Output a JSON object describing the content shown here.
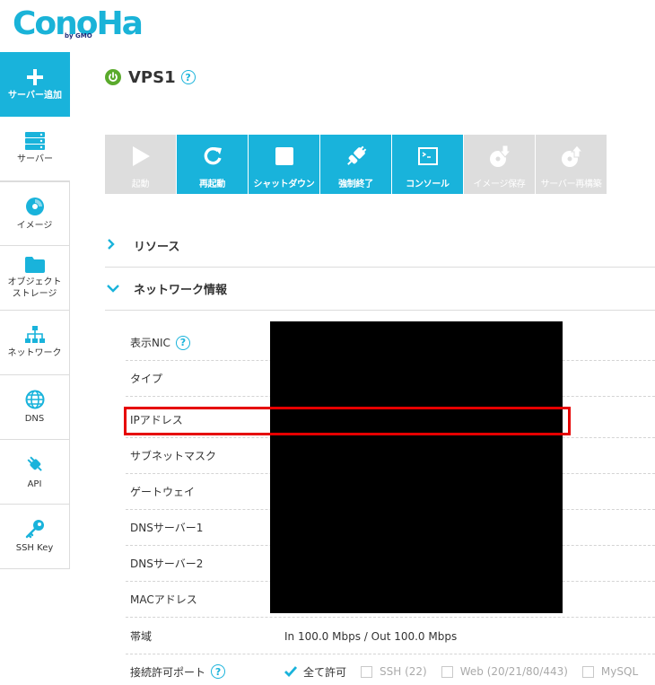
{
  "brand": {
    "logo_text": "ConoHa",
    "logo_sub": "by GMO"
  },
  "sidebar": {
    "items": [
      {
        "label": "サーバー追加"
      },
      {
        "label": "サーバー"
      },
      {
        "label": "イメージ"
      },
      {
        "label": "オブジェクト\nストレージ"
      },
      {
        "label": "ネットワーク"
      },
      {
        "label": "DNS"
      },
      {
        "label": "API"
      },
      {
        "label": "SSH Key"
      }
    ]
  },
  "header": {
    "title": "VPS1",
    "help": "?"
  },
  "toolbar": {
    "buttons": [
      {
        "label": "起動",
        "enabled": false
      },
      {
        "label": "再起動",
        "enabled": true
      },
      {
        "label": "シャットダウン",
        "enabled": true
      },
      {
        "label": "強制終了",
        "enabled": true
      },
      {
        "label": "コンソール",
        "enabled": true
      },
      {
        "label": "イメージ保存",
        "enabled": false
      },
      {
        "label": "サーバー再構築",
        "enabled": false
      }
    ]
  },
  "sections": {
    "resource": {
      "label": "リソース",
      "expanded": false
    },
    "network": {
      "label": "ネットワーク情報",
      "expanded": true
    }
  },
  "network": {
    "rows": [
      {
        "key": "表示NIC",
        "value": ""
      },
      {
        "key": "タイプ",
        "value": ""
      },
      {
        "key": "IPアドレス",
        "value": ""
      },
      {
        "key": "サブネットマスク",
        "value": ""
      },
      {
        "key": "ゲートウェイ",
        "value": ""
      },
      {
        "key": "DNSサーバー1",
        "value": ""
      },
      {
        "key": "DNSサーバー2",
        "value": ""
      },
      {
        "key": "MACアドレス",
        "value": ""
      },
      {
        "key": "帯域",
        "value": "In 100.0 Mbps / Out 100.0 Mbps"
      },
      {
        "key": "接続許可ポート",
        "value": ""
      }
    ],
    "ports": [
      {
        "label": "全て許可",
        "checked": true
      },
      {
        "label": "SSH (22)",
        "checked": false
      },
      {
        "label": "Web (20/21/80/443)",
        "checked": false
      },
      {
        "label": "MySQL",
        "checked": false
      }
    ]
  },
  "colors": {
    "accent": "#19b3db",
    "disabled": "#dddddd",
    "power": "#5aaa2c",
    "highlight": "#e60000"
  }
}
